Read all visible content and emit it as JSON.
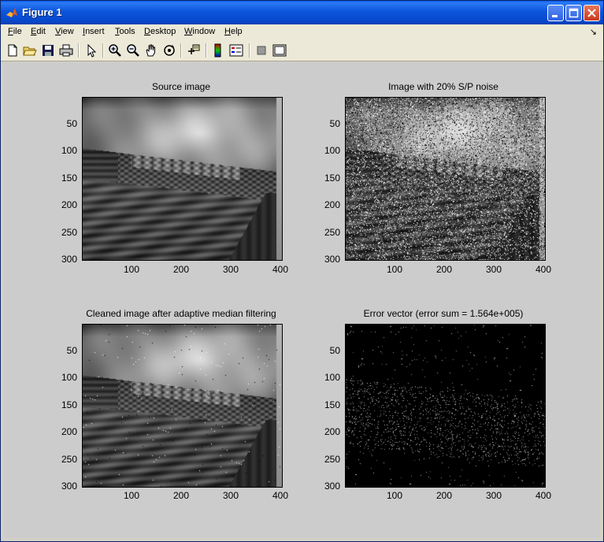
{
  "window": {
    "title": "Figure 1"
  },
  "menu": {
    "items": [
      {
        "label": "File",
        "key": "F",
        "rest": "ile"
      },
      {
        "label": "Edit",
        "key": "E",
        "rest": "dit"
      },
      {
        "label": "View",
        "key": "V",
        "rest": "iew"
      },
      {
        "label": "Insert",
        "key": "I",
        "rest": "nsert"
      },
      {
        "label": "Tools",
        "key": "T",
        "rest": "ools"
      },
      {
        "label": "Desktop",
        "key": "D",
        "rest": "esktop"
      },
      {
        "label": "Window",
        "key": "W",
        "rest": "indow"
      },
      {
        "label": "Help",
        "key": "H",
        "rest": "elp"
      }
    ]
  },
  "toolbar": {
    "icons": [
      "new-file-icon",
      "open-file-icon",
      "save-icon",
      "print-icon",
      "pointer-icon",
      "zoom-in-icon",
      "zoom-out-icon",
      "pan-icon",
      "rotate-icon",
      "data-cursor-icon",
      "colorbar-icon",
      "legend-icon",
      "hide-plot-tools-icon",
      "show-plot-tools-icon"
    ]
  },
  "axes": [
    {
      "title": "Source image",
      "yticks": [
        "50",
        "100",
        "150",
        "200",
        "250",
        "300"
      ],
      "xticks": [
        "100",
        "200",
        "300",
        "400"
      ],
      "image": "source"
    },
    {
      "title": "Image with 20% S/P noise",
      "yticks": [
        "50",
        "100",
        "150",
        "200",
        "250",
        "300"
      ],
      "xticks": [
        "100",
        "200",
        "300",
        "400"
      ],
      "image": "noisy"
    },
    {
      "title": "Cleaned image after adaptive median filtering",
      "yticks": [
        "50",
        "100",
        "150",
        "200",
        "250",
        "300"
      ],
      "xticks": [
        "100",
        "200",
        "300",
        "400"
      ],
      "image": "cleaned"
    },
    {
      "title": "Error vector (error sum = 1.564e+005)",
      "yticks": [
        "50",
        "100",
        "150",
        "200",
        "250",
        "300"
      ],
      "xticks": [
        "100",
        "200",
        "300",
        "400"
      ],
      "image": "error"
    }
  ],
  "colors": {
    "figure_bg": "#cccccc",
    "titlebar": "#0b55dc"
  }
}
